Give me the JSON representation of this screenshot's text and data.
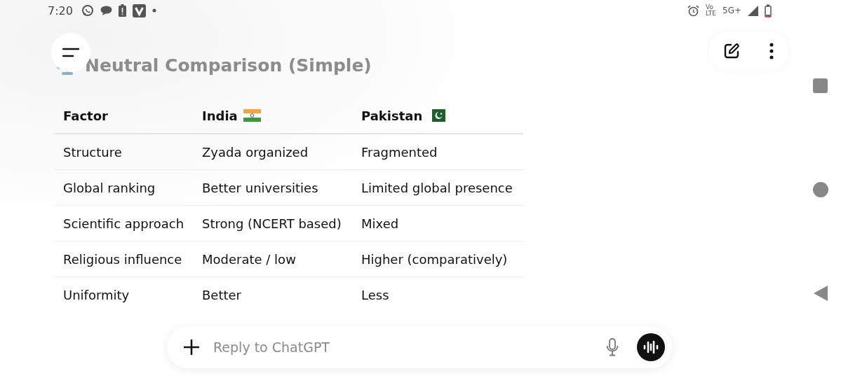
{
  "status_bar": {
    "time": "7:20",
    "network_texts": [
      "Vo",
      "LTE",
      "5G+"
    ]
  },
  "header": {
    "title": "Neutral Comparison (Simple)"
  },
  "table": {
    "columns": [
      {
        "label": "Factor",
        "kind": "plain"
      },
      {
        "label": "India",
        "kind": "india"
      },
      {
        "label": "Pakistan",
        "kind": "pakistan"
      }
    ],
    "rows": [
      [
        "Structure",
        "Zyada organized",
        "Fragmented"
      ],
      [
        "Global ranking",
        "Better universities",
        "Limited global presence"
      ],
      [
        "Scientific approach",
        "Strong (NCERT based)",
        "Mixed"
      ],
      [
        "Religious influence",
        "Moderate / low",
        "Higher (comparatively)"
      ],
      [
        "Uniformity",
        "Better",
        "Less"
      ]
    ]
  },
  "composer": {
    "placeholder": "Reply to ChatGPT"
  }
}
